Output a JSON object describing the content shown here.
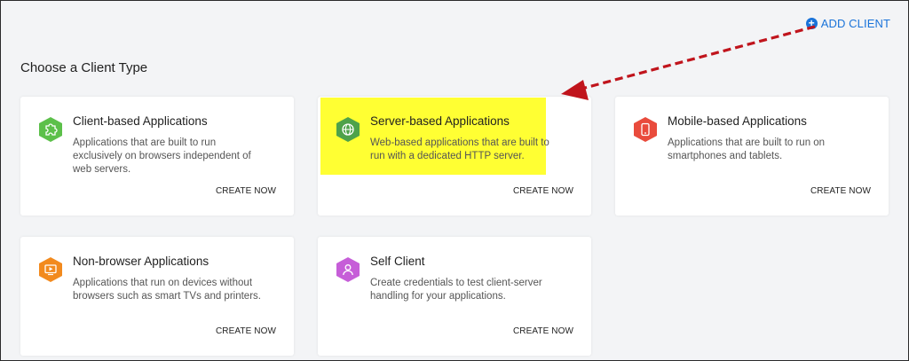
{
  "header": {
    "add_client_label": "ADD CLIENT",
    "page_title": "Choose a Client Type"
  },
  "colors": {
    "accent": "#1a73d9",
    "highlight": "#ffff33",
    "arrow": "#c0141c"
  },
  "cards": [
    {
      "title": "Client-based Applications",
      "description": "Applications that are built to run exclusively on browsers independent of web servers.",
      "action": "CREATE NOW",
      "icon": "puzzle-icon",
      "icon_color": "#5cc04a"
    },
    {
      "title": "Server-based Applications",
      "description": "Web-based applications that are built to run with a dedicated HTTP server.",
      "action": "CREATE NOW",
      "icon": "globe-icon",
      "icon_color": "#4ea24a"
    },
    {
      "title": "Mobile-based Applications",
      "description": "Applications that are built to run on smartphones and tablets.",
      "action": "CREATE NOW",
      "icon": "mobile-icon",
      "icon_color": "#e94b3c"
    },
    {
      "title": "Non-browser Applications",
      "description": "Applications that run on devices without browsers such as smart TVs and printers.",
      "action": "CREATE NOW",
      "icon": "play-screen-icon",
      "icon_color": "#f28a1e"
    },
    {
      "title": "Self Client",
      "description": "Create credentials to test client-server handling for your applications.",
      "action": "CREATE NOW",
      "icon": "user-icon",
      "icon_color": "#c65ed8"
    }
  ]
}
